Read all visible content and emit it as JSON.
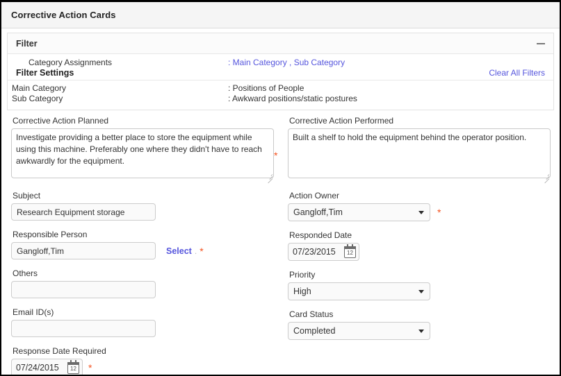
{
  "window": {
    "title": "Corrective Action Cards"
  },
  "filter": {
    "header_title": "Filter",
    "collapse_icon": "minus-icon",
    "category_assignments_label": "Category Assignments",
    "category_assignments_value": ": Main Category , Sub Category",
    "settings_title": "Filter Settings",
    "clear_all_label": "Clear All Filters",
    "settings": [
      {
        "key": "Main Category",
        "value": ": Positions of People"
      },
      {
        "key": "Sub Category",
        "value": ": Awkward positions/static postures"
      }
    ]
  },
  "form": {
    "left": {
      "planned_label": "Corrective Action Planned",
      "planned_value": "Investigate providing a better place to store the equipment while using this machine. Preferably one where they didn't have to reach awkwardly for the equipment.",
      "subject_label": "Subject",
      "subject_value": "Research Equipment storage",
      "responsible_label": "Responsible Person",
      "responsible_value": "Gangloff,Tim",
      "select_link": "Select",
      "others_label": "Others",
      "others_value": "",
      "email_label": "Email ID(s)",
      "email_value": "",
      "response_date_label": "Response Date Required",
      "response_date_value": "07/24/2015"
    },
    "right": {
      "performed_label": "Corrective Action Performed",
      "performed_value": "Built a shelf to hold the equipment behind the operator position.",
      "action_owner_label": "Action Owner",
      "action_owner_value": "Gangloff,Tim",
      "responded_date_label": "Responded Date",
      "responded_date_value": "07/23/2015",
      "priority_label": "Priority",
      "priority_value": "High",
      "card_status_label": "Card Status",
      "card_status_value": "Completed"
    }
  },
  "icons": {
    "calendar_day": "12",
    "required_marker": "*"
  },
  "colors": {
    "link": "#5555dd",
    "required": "#f4511e",
    "titlebar_bg": "#f5f5f5",
    "border": "#000000"
  }
}
